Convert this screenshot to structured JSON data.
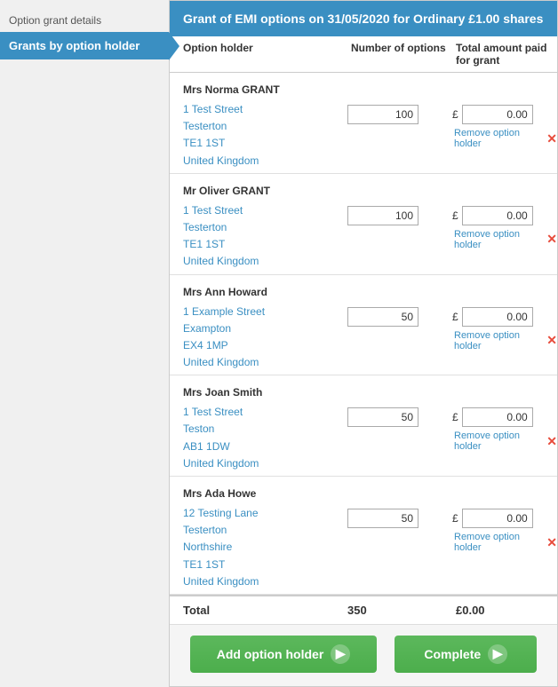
{
  "sidebar": {
    "static_label": "Option grant details",
    "active_item": "Grants by option holder"
  },
  "header": {
    "title": "Grant of EMI options on 31/05/2020 for Ordinary £1.00 shares"
  },
  "table": {
    "col1": "Option holder",
    "col2": "Number of options",
    "col3": "Total amount paid for grant"
  },
  "holders": [
    {
      "name": "Mrs Norma GRANT",
      "address": [
        "1 Test Street",
        "Testerton",
        "TE1 1ST",
        "United Kingdom"
      ],
      "options": "100",
      "amount": "0.00"
    },
    {
      "name": "Mr Oliver GRANT",
      "address": [
        "1 Test Street",
        "Testerton",
        "TE1 1ST",
        "United Kingdom"
      ],
      "options": "100",
      "amount": "0.00"
    },
    {
      "name": "Mrs Ann Howard",
      "address": [
        "1 Example Street",
        "Exampton",
        "EX4 1MP",
        "United Kingdom"
      ],
      "options": "50",
      "amount": "0.00"
    },
    {
      "name": "Mrs Joan Smith",
      "address": [
        "1 Test Street",
        "Teston",
        "AB1 1DW",
        "United Kingdom"
      ],
      "options": "50",
      "amount": "0.00"
    },
    {
      "name": "Mrs Ada Howe",
      "address": [
        "12 Testing Lane",
        "Testerton",
        "Northshire",
        "TE1 1ST",
        "United Kingdom"
      ],
      "options": "50",
      "amount": "0.00"
    }
  ],
  "total": {
    "label": "Total",
    "options": "350",
    "amount": "£0.00"
  },
  "buttons": {
    "add": "Add option holder",
    "complete": "Complete"
  },
  "remove_label": "Remove option holder"
}
